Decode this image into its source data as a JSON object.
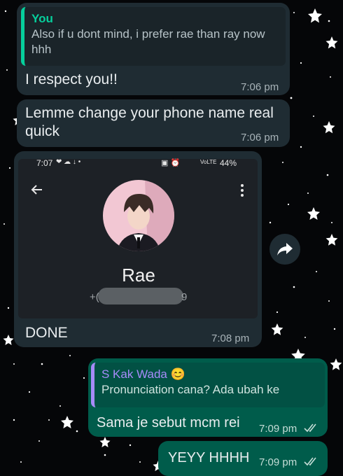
{
  "colors": {
    "background": "#050608",
    "incoming_bubble": "#1f2c33",
    "outgoing_bubble": "#005c4b",
    "quote_you": "#06cf9c",
    "quote_kak_wada": "#a78bfa",
    "read_ticks": "#53bdeb"
  },
  "messages": [
    {
      "type": "incoming",
      "quote_author": "You",
      "quote_text": "Also if u dont mind, i prefer rae than ray now hhh",
      "text": "I respect you!!",
      "time": "7:06 pm"
    },
    {
      "type": "incoming",
      "text": "Lemme change your phone name real quick",
      "time": "7:06 pm"
    },
    {
      "type": "incoming",
      "image": {
        "status_time": "7:07",
        "status_icons": "❤ ☁ ↓ •",
        "status_right_icons": "▣ ⏰",
        "network": "VoLTE",
        "battery": "44%",
        "back_icon": "arrow-left-icon",
        "menu_icon": "more-vertical-icon",
        "contact_name": "Rae",
        "phone_prefix": "+(",
        "phone_suffix": "9"
      },
      "text": "DONE",
      "time": "7:08 pm"
    },
    {
      "type": "outgoing",
      "quote_author": "S Kak Wada 😊",
      "quote_text": "Pronunciation cana? Ada ubah ke",
      "text": "Sama je sebut mcm rei",
      "time": "7:09 pm"
    },
    {
      "type": "outgoing",
      "text": "YEYY HHHH",
      "time": "7:09 pm"
    }
  ],
  "forward_icon": "forward-icon"
}
